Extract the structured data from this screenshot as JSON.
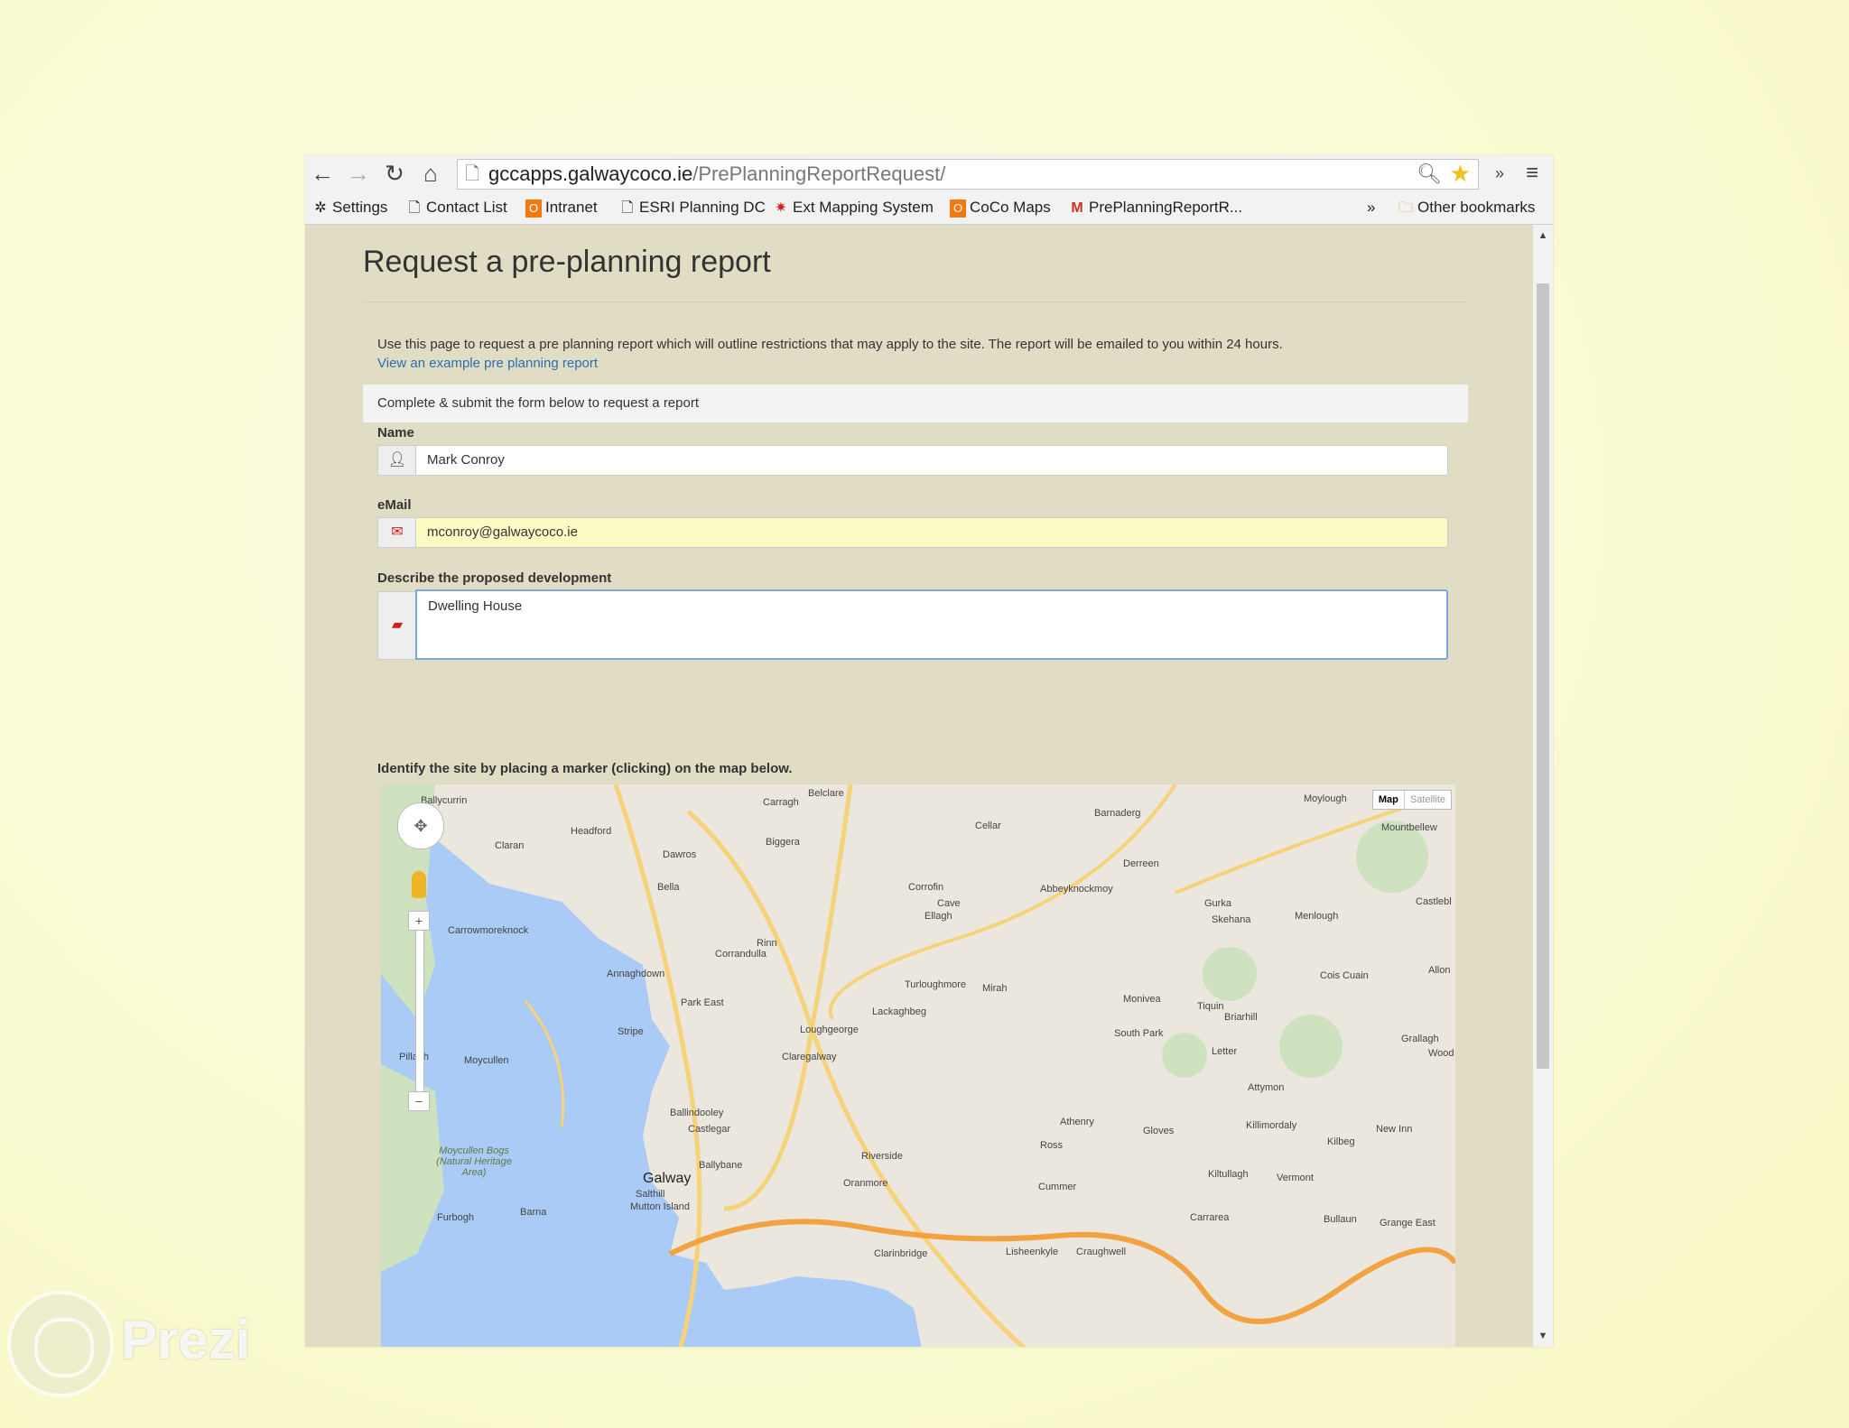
{
  "browser": {
    "url_host": "gccapps.galwaycoco.ie",
    "url_path": "/PrePlanningReportRequest/",
    "bookmarks": [
      "Settings",
      "Contact List",
      "Intranet",
      "ESRI Planning DC",
      "Ext Mapping System",
      "CoCo Maps",
      "PrePlanningReportR...",
      "Other bookmarks"
    ],
    "overflow_label": "»"
  },
  "page": {
    "title": "Request a pre-planning report",
    "intro": "Use this page to request a pre planning report which will outline restrictions that may apply to the site. The report will be emailed to you within 24 hours.",
    "example_link": "View an example pre planning report",
    "panel_text": "Complete & submit the form below to request a report"
  },
  "form": {
    "name_label": "Name",
    "name_value": "Mark Conroy",
    "email_label": "eMail",
    "email_value": "mconroy@galwaycoco.ie",
    "desc_label": "Describe the proposed development",
    "desc_value": "Dwelling House",
    "map_label": "Identify the site by placing a marker (clicking) on the map below."
  },
  "map": {
    "type_map": "Map",
    "type_satellite": "Satellite",
    "places": [
      "Ballycurrin",
      "Headford",
      "Claran",
      "Dawros",
      "Biggera",
      "Carragh",
      "Belclare",
      "Cellar",
      "Barnaderg",
      "Moylough",
      "Mountbellew",
      "Derreen",
      "Abbeyknockmoy",
      "Corrofin",
      "Cave",
      "Ellagh",
      "Bella",
      "Carrowmoreknock",
      "Rinn",
      "Corrandulla",
      "Annaghdown",
      "Park East",
      "Turloughmore",
      "Mirah",
      "Lackaghbeg",
      "Monivea",
      "Tiquin",
      "Briarhill",
      "Gurka",
      "Skehana",
      "Menlough",
      "Cois Cuain",
      "Castlebl",
      "Stripe",
      "Loughgeorge",
      "Claregalway",
      "South Park",
      "Letter",
      "Grallagh",
      "Wood",
      "Allon",
      "Pillagh",
      "Moycullen",
      "Attymon",
      "Ballindooley",
      "Castlegar",
      "Athenry",
      "Gloves",
      "Killimordaly",
      "Kilbeg",
      "New Inn",
      "Ballybane",
      "Riverside",
      "Oranmore",
      "Ross",
      "Kiltullagh",
      "Vermont",
      "Galway",
      "Salthill",
      "Mutton Island",
      "Cummer",
      "Carrarea",
      "Bullaun",
      "Grange East",
      "Furbogh",
      "Barna",
      "Clarinbridge",
      "Lisheenkyle",
      "Craughwell",
      "Moycullen Bogs (Natural Heritage Area)"
    ]
  },
  "watermark": {
    "text": "Prezi"
  }
}
